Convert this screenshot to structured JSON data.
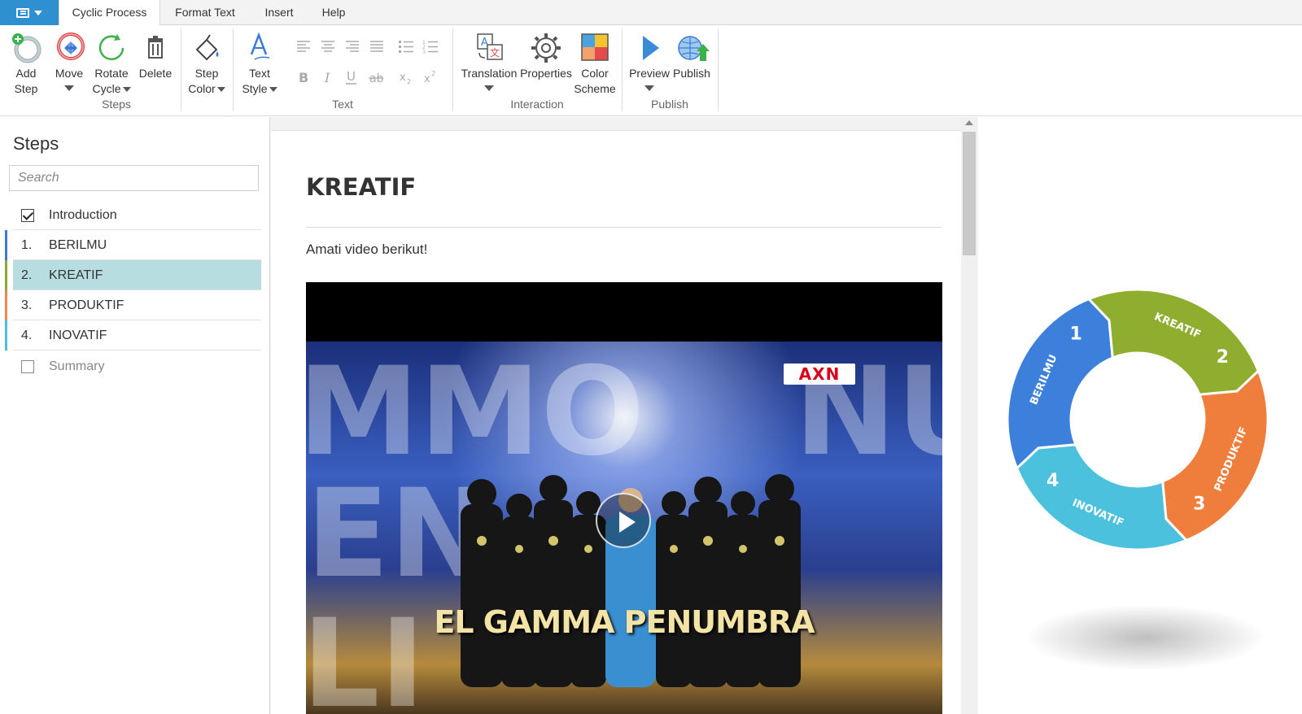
{
  "tabs": [
    {
      "label": "Cyclic Process",
      "active": true
    },
    {
      "label": "Format Text"
    },
    {
      "label": "Insert"
    },
    {
      "label": "Help"
    }
  ],
  "ribbon": {
    "steps_group": {
      "label": "Steps",
      "add_step": "Add\nStep",
      "move": "Move",
      "rotate_cycle": "Rotate\nCycle",
      "delete": "Delete",
      "step_color": "Step\nColor"
    },
    "text_group": {
      "label": "Text",
      "text_style": "Text\nStyle"
    },
    "interaction_group": {
      "label": "Interaction",
      "translation": "Translation",
      "properties": "Properties",
      "color_scheme": "Color\nScheme"
    },
    "publish_group": {
      "label": "Publish",
      "preview": "Preview",
      "publish": "Publish"
    }
  },
  "steps_panel": {
    "title": "Steps",
    "search_placeholder": "Search",
    "intro": {
      "label": "Introduction",
      "checked": true
    },
    "items": [
      {
        "num": "1.",
        "label": "BERILMU",
        "color": "#3a7bd5"
      },
      {
        "num": "2.",
        "label": "KREATIF",
        "color": "#8aab2d",
        "selected": true
      },
      {
        "num": "3.",
        "label": "PRODUKTIF",
        "color": "#f0874a"
      },
      {
        "num": "4.",
        "label": "INOVATIF",
        "color": "#4bbfdc"
      }
    ],
    "summary": {
      "label": "Summary",
      "checked": false
    }
  },
  "editor": {
    "heading": "KREATIF",
    "instruction": "Amati video berikut!",
    "video": {
      "badge": "AXN",
      "caption": "EL GAMMA PENUMBRA"
    }
  },
  "cycle": {
    "segments": [
      {
        "num": "1",
        "label": "BERILMU",
        "color": "#3d80db"
      },
      {
        "num": "2",
        "label": "KREATIF",
        "color": "#8fae30"
      },
      {
        "num": "3",
        "label": "PRODUKTIF",
        "color": "#ef7d3c"
      },
      {
        "num": "4",
        "label": "INOVATIF",
        "color": "#4cc1de"
      }
    ]
  }
}
